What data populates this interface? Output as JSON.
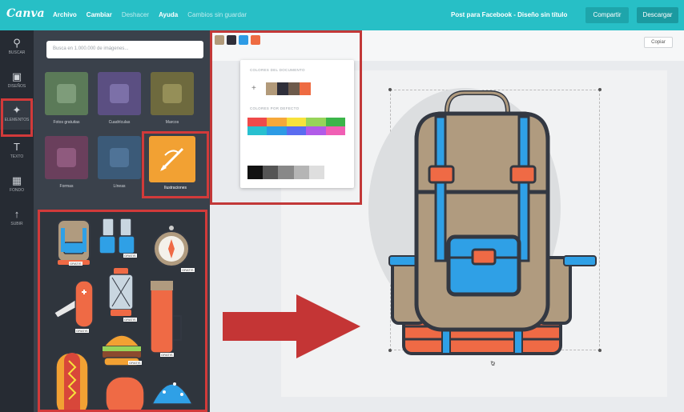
{
  "topbar": {
    "logo": "Canva",
    "menu": [
      "Archivo",
      "Cambiar",
      "Deshacer",
      "Ayuda",
      "Cambios sin guardar"
    ],
    "document_title": "Post para Facebook - Diseño sin título",
    "share_label": "Compartir",
    "download_label": "Descargar"
  },
  "sidebar": {
    "items": [
      {
        "label": "BUSCAR",
        "icon": "search-icon"
      },
      {
        "label": "DISEÑOS",
        "icon": "layouts-icon"
      },
      {
        "label": "ELEMENTOS",
        "icon": "shapes-icon"
      },
      {
        "label": "TEXTO",
        "icon": "text-icon"
      },
      {
        "label": "FONDO",
        "icon": "background-icon"
      },
      {
        "label": "SUBIR",
        "icon": "upload-icon"
      }
    ]
  },
  "panel": {
    "search_placeholder": "Busca en 1.000.000 de imágenes...",
    "categories": [
      "Fotos gratuitas",
      "Cuadrículas",
      "Marcos",
      "Formas",
      "Líneas",
      "Ilustraciones"
    ]
  },
  "grid": {
    "badges": [
      "GRATIS",
      "GRATIS",
      "GRATIS",
      "GRATIS",
      "GRATIS",
      "GRATIS",
      "GRATIS"
    ]
  },
  "workspace": {
    "copy_label": "Copiar"
  },
  "color_picker": {
    "current_swatches": [
      "#b29a7a",
      "#2f2f3a",
      "#2d9be5",
      "#ee6b42"
    ],
    "document_colors_label": "COLORES DEL DOCUMENTO",
    "default_colors_label": "COLORES POR DEFECTO",
    "document_colors": [
      "#b29a7a",
      "#2f2f3a",
      "#6d5a4b",
      "#ee6b42"
    ],
    "default_colors": [
      "#ef4a4a",
      "#f6a83a",
      "#f7e23b",
      "#97d45a",
      "#3bb54a",
      "#28c0d0",
      "#2d9be5",
      "#5a6cf0",
      "#b15be8",
      "#f05fb4"
    ],
    "grays": [
      "#111111",
      "#555555",
      "#888888",
      "#b5b5b5",
      "#dedede"
    ]
  },
  "artwork": {
    "page_number": "2",
    "colors": {
      "tan": "#b09b7f",
      "outline": "#333842",
      "blue": "#2fa0e6",
      "orange": "#ef6a45",
      "arrow": "#c43535"
    }
  }
}
